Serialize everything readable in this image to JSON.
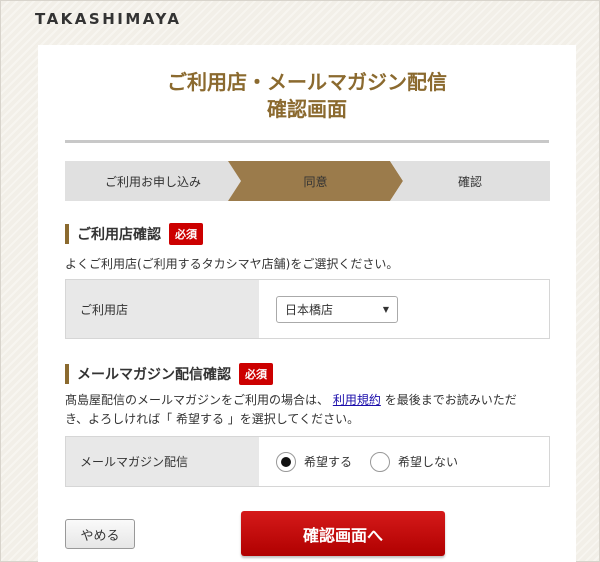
{
  "brand": {
    "logo": "TAKASHIMAYA"
  },
  "page": {
    "title_line1": "ご利用店・メールマガジン配信",
    "title_line2": "確認画面"
  },
  "steps": [
    {
      "label": "ご利用お申し込み",
      "state": "done"
    },
    {
      "label": "同意",
      "state": "active"
    },
    {
      "label": "確認",
      "state": "pending"
    }
  ],
  "colors": {
    "accent": "#8b6a2f",
    "required": "#cc0000",
    "step_active": "#9b7b4b",
    "step_inactive": "#e0e0e0"
  },
  "store_section": {
    "title": "ご利用店確認",
    "required_badge": "必須",
    "note": "よくご利用店(ご利用するタカシマヤ店舗)をご選択ください。",
    "field_label": "ご利用店",
    "selected_store": "日本橋店"
  },
  "mail_section": {
    "title": "メールマガジン配信確認",
    "required_badge": "必須",
    "note_part1": "髙島屋配信のメールマガジンをご利用の場合は、",
    "terms_link": "利用規約",
    "note_part2": "を最後までお読みいただ",
    "note_line2": "き、よろしければ「 希望する 」を選択してください。",
    "field_label": "メールマガジン配信",
    "option_yes": "希望する",
    "option_no": "希望しない",
    "selected": "希望する"
  },
  "actions": {
    "cancel_label": "やめる",
    "confirm_label": "確認画面へ"
  }
}
